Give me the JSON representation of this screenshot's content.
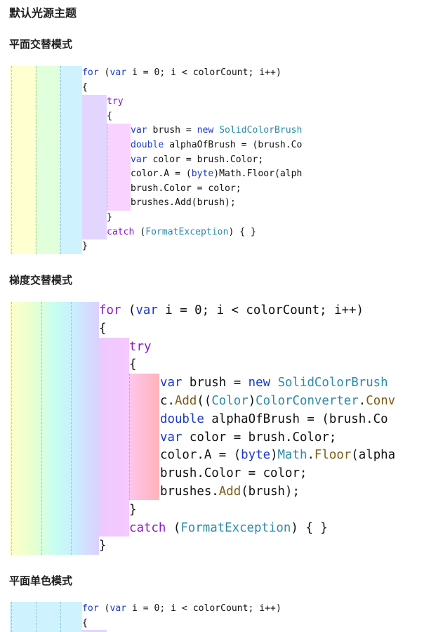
{
  "page": {
    "title": "默认光源主题"
  },
  "theme": {
    "keyword_color": "#1a39c8",
    "control_color": "#8a1bc2",
    "type_color": "#2b8aa8",
    "method_color": "#7a5a12",
    "text_color": "#111111"
  },
  "sections": [
    {
      "heading": "平面交替模式",
      "lines": [
        [
          {
            "t": "for",
            "c": "kw"
          },
          {
            "t": " (",
            "c": "tx"
          },
          {
            "t": "var",
            "c": "kw"
          },
          {
            "t": " i = 0; i < colorCount; i++)",
            "c": "tx"
          }
        ],
        [
          {
            "t": "{",
            "c": "tx"
          }
        ],
        [
          {
            "t": "try",
            "c": "ctl"
          }
        ],
        [
          {
            "t": "{",
            "c": "tx"
          }
        ],
        [
          {
            "t": "var",
            "c": "kw"
          },
          {
            "t": " brush = ",
            "c": "tx"
          },
          {
            "t": "new",
            "c": "kw"
          },
          {
            "t": " ",
            "c": "tx"
          },
          {
            "t": "SolidColorBrush",
            "c": "ty"
          }
        ],
        [
          {
            "t": "double",
            "c": "kw"
          },
          {
            "t": " alphaOfBrush = (brush.Co",
            "c": "tx"
          }
        ],
        [
          {
            "t": "var",
            "c": "kw"
          },
          {
            "t": " color = brush.Color;",
            "c": "tx"
          }
        ],
        [
          {
            "t": "color.A = (",
            "c": "tx"
          },
          {
            "t": "byte",
            "c": "kw"
          },
          {
            "t": ")Math.Floor(alph",
            "c": "tx"
          }
        ],
        [
          {
            "t": "brush.Color = color;",
            "c": "tx"
          }
        ],
        [
          {
            "t": "brushes.Add(brush);",
            "c": "tx"
          }
        ],
        [
          {
            "t": "}",
            "c": "tx"
          }
        ],
        [
          {
            "t": "catch",
            "c": "ctl"
          },
          {
            "t": " (",
            "c": "tx"
          },
          {
            "t": "FormatException",
            "c": "ty"
          },
          {
            "t": ") { }",
            "c": "tx"
          }
        ],
        [
          {
            "t": "}",
            "c": "tx"
          }
        ]
      ]
    },
    {
      "heading": "梯度交替模式",
      "lines": [
        [
          {
            "t": "for",
            "c": "ctl"
          },
          {
            "t": " (",
            "c": "tx"
          },
          {
            "t": "var",
            "c": "kw"
          },
          {
            "t": " i = 0; i < colorCount; i++)",
            "c": "tx"
          }
        ],
        [
          {
            "t": "{",
            "c": "tx"
          }
        ],
        [
          {
            "t": "try",
            "c": "ctl"
          }
        ],
        [
          {
            "t": "{",
            "c": "tx"
          }
        ],
        [
          {
            "t": "var",
            "c": "kw"
          },
          {
            "t": " brush = ",
            "c": "tx"
          },
          {
            "t": "new",
            "c": "kw"
          },
          {
            "t": " ",
            "c": "tx"
          },
          {
            "t": "SolidColorBrush",
            "c": "ty"
          }
        ],
        [
          {
            "t": "c.",
            "c": "tx"
          },
          {
            "t": "Add",
            "c": "me"
          },
          {
            "t": "((",
            "c": "tx"
          },
          {
            "t": "Color",
            "c": "ty"
          },
          {
            "t": ")",
            "c": "tx"
          },
          {
            "t": "ColorConverter",
            "c": "ty"
          },
          {
            "t": ".",
            "c": "tx"
          },
          {
            "t": "Conv",
            "c": "me"
          }
        ],
        [
          {
            "t": "double",
            "c": "kw"
          },
          {
            "t": " alphaOfBrush = (brush.Co",
            "c": "tx"
          }
        ],
        [
          {
            "t": "var",
            "c": "kw"
          },
          {
            "t": " color = brush.Color;",
            "c": "tx"
          }
        ],
        [
          {
            "t": "color.A = (",
            "c": "tx"
          },
          {
            "t": "byte",
            "c": "kw"
          },
          {
            "t": ")",
            "c": "tx"
          },
          {
            "t": "Math",
            "c": "ty"
          },
          {
            "t": ".",
            "c": "tx"
          },
          {
            "t": "Floor",
            "c": "me"
          },
          {
            "t": "(alpha",
            "c": "tx"
          }
        ],
        [
          {
            "t": "brush.Color = color;",
            "c": "tx"
          }
        ],
        [
          {
            "t": "brushes.",
            "c": "tx"
          },
          {
            "t": "Add",
            "c": "me"
          },
          {
            "t": "(brush);",
            "c": "tx"
          }
        ],
        [
          {
            "t": "}",
            "c": "tx"
          }
        ],
        [
          {
            "t": "catch",
            "c": "ctl"
          },
          {
            "t": " (",
            "c": "tx"
          },
          {
            "t": "FormatException",
            "c": "ty"
          },
          {
            "t": ") { }",
            "c": "tx"
          }
        ],
        [
          {
            "t": "}",
            "c": "tx"
          }
        ]
      ]
    },
    {
      "heading": "平面单色模式",
      "lines": [
        [
          {
            "t": "for",
            "c": "kw"
          },
          {
            "t": " (",
            "c": "tx"
          },
          {
            "t": "var",
            "c": "kw"
          },
          {
            "t": " i = 0; i < colorCount; i++)",
            "c": "tx"
          }
        ],
        [
          {
            "t": "{",
            "c": "tx"
          }
        ]
      ]
    }
  ]
}
